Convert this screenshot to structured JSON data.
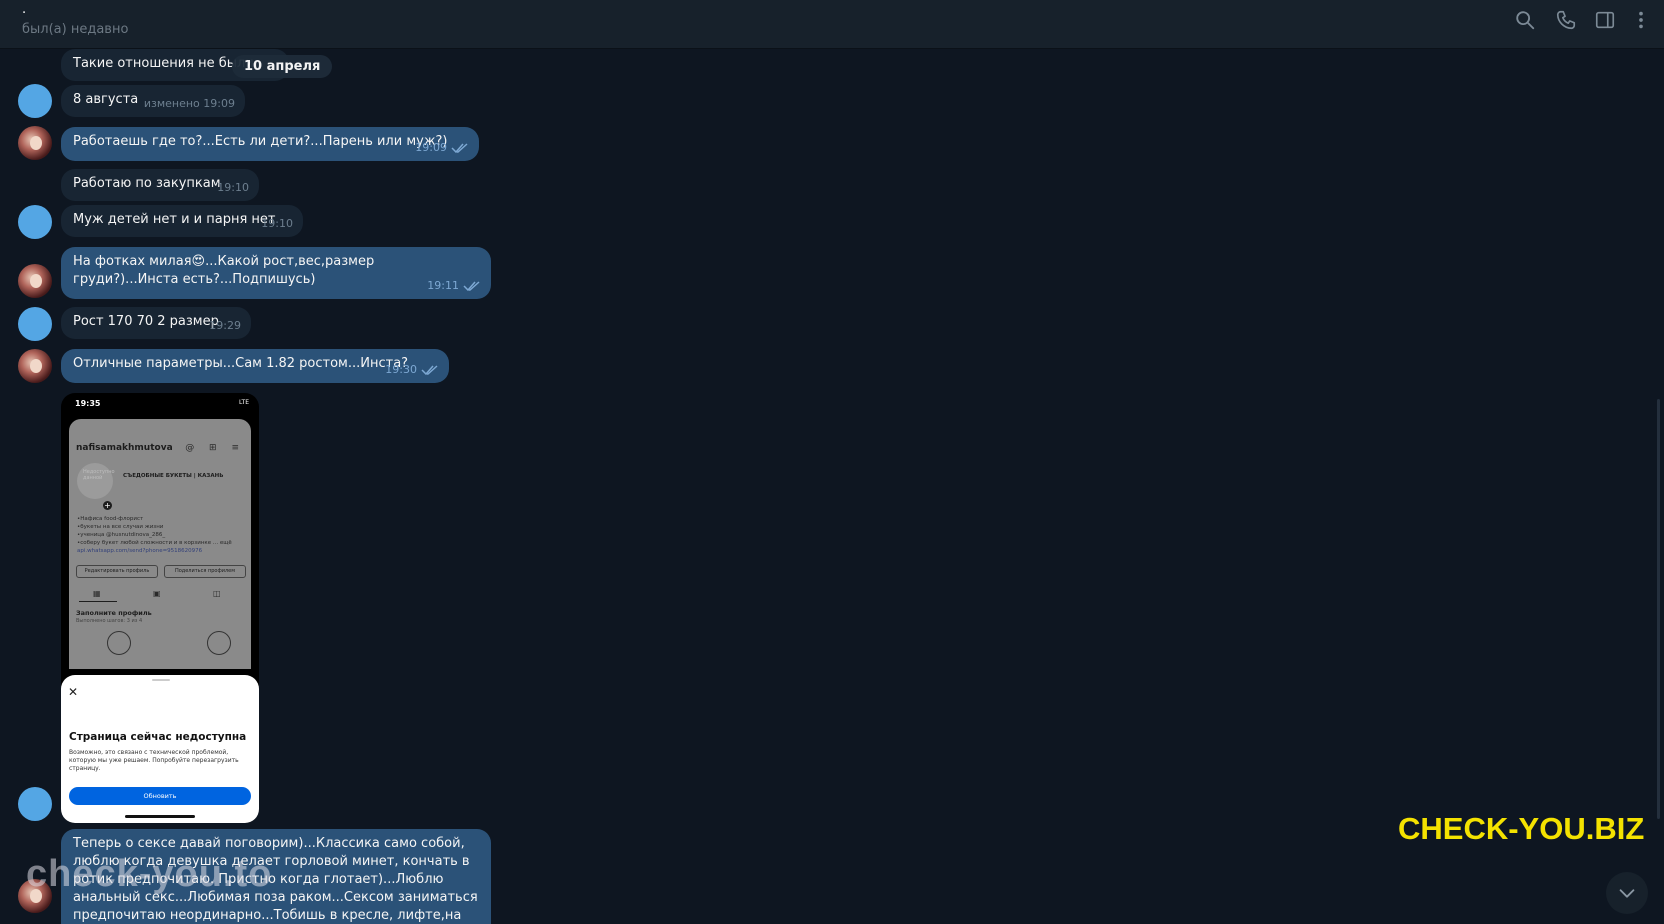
{
  "header": {
    "title": ".",
    "status": "был(а) недавно",
    "icons": [
      "search-icon",
      "phone-icon",
      "sidebar-toggle-icon",
      "more-vertical-icon"
    ]
  },
  "date_pill": "10 апреля",
  "messages": [
    {
      "dir": "in",
      "text": "Такие отношения не были",
      "time": ""
    },
    {
      "dir": "in",
      "text": "8 августа",
      "time": "изменено 19:09"
    },
    {
      "dir": "out",
      "text": "Работаешь где то?...Есть ли дети?...Парень или муж?)",
      "time": "19:09"
    },
    {
      "dir": "in",
      "text": "Работаю по закупкам",
      "time": "19:10"
    },
    {
      "dir": "in",
      "text": "Муж детей нет и и парня нет",
      "time": "19:10"
    },
    {
      "dir": "out",
      "text": "На фотках милая😍...Какой рост,вес,размер груди?)...Инста есть?...Подпишусь)",
      "time": "19:11"
    },
    {
      "dir": "in",
      "text": "Рост 170 70 2 размер",
      "time": "19:29"
    },
    {
      "dir": "out",
      "text": "Отличные параметры...Сам 1.82 ростом...Инста?",
      "time": "19:30"
    },
    {
      "dir": "out",
      "text": "Теперь о сексе давай поговорим)...Классика само собой, люблю когда девушка делает горловой минет, кончать в ротик предпочитаю. Пристно когда глотает)...Люблю анальный секс...Любимая поза раком...Сексом заниматься предпочитаю неординарно...Тобишь в кресле, лифте,на столе...Хочу",
      "time": ""
    }
  ],
  "phone_screenshot": {
    "time": "19:35",
    "signal": "LTE",
    "username": "nafisamakhmutova",
    "avatar_hint": "Недоступно данной",
    "business_name": "СЪЕДОБНЫЕ БУКЕТЫ | КАЗАНЬ",
    "bio_lines": [
      "•Нафиса food-флорист",
      "•букеты на все случаи жизни",
      "•ученица @husnutdinova_286_",
      "•соберу букет любой сложности и в корзинке ... ещё"
    ],
    "bio_link": "api.whatsapp.com/send?phone=9518620976",
    "edit_button": "Редактировать профиль",
    "share_button": "Поделиться профилем",
    "fill_profile": "Заполните профиль",
    "fill_progress": "Выполнено шагов: 3 из 4",
    "sheet_title": "Страница сейчас недоступна",
    "sheet_text": "Возможно, это связано с технической проблемой, которую мы уже решаем. Попробуйте перезагрузить страницу.",
    "sheet_button": "Обновить"
  },
  "watermark": "CHECK-YOU.BIZ",
  "watermark_overlay": "check-you.to",
  "colors": {
    "background": "#0e1621",
    "header": "#17212b",
    "bubble_in": "#182533",
    "bubble_out": "#2b5278",
    "avatar_blue": "#54a6e4",
    "watermark": "#f4e200"
  }
}
